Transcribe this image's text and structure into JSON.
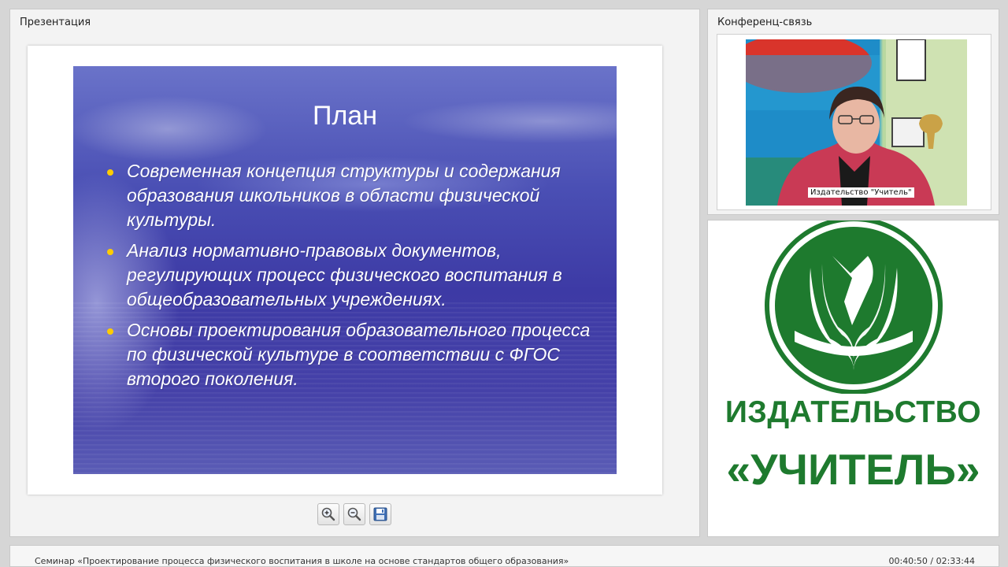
{
  "presentation": {
    "title": "Презентация",
    "slide": {
      "title": "План",
      "bullets": [
        "Современная концепция структуры и содержания образования школьников в области физической культуры.",
        "Анализ нормативно-правовых документов, регулирующих процесс физического воспитания в общеобразовательных учреждениях.",
        "Основы проектирования образовательного процесса по физической культуре в соответствии с ФГОС второго поколения."
      ],
      "bullet_color": "#ffcc00"
    },
    "tools": [
      "zoom-in-icon",
      "zoom-out-icon",
      "save-icon"
    ]
  },
  "conference": {
    "title": "Конференц-связь",
    "video_label": "Издательство \"Учитель\""
  },
  "logo": {
    "line1": "ИЗДАТЕЛЬСТВО",
    "line2": "«УЧИТЕЛЬ»",
    "brand_color": "#1e7a2e"
  },
  "footer": {
    "title": "Семинар «Проектирование процесса физического воспитания в школе на основе стандартов общего образования»",
    "time": "00:40:50 / 02:33:44"
  }
}
